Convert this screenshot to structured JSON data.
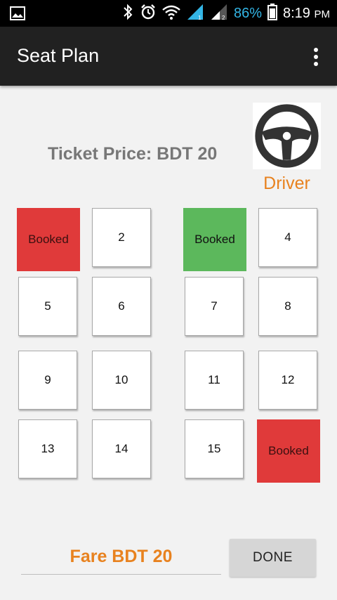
{
  "status_bar": {
    "battery_percent": "86%",
    "time": "8:19",
    "am_pm": "PM",
    "icons": [
      "image-icon",
      "bluetooth-icon",
      "alarm-icon",
      "wifi-icon",
      "signal-1-icon",
      "signal-2-icon",
      "battery-icon"
    ]
  },
  "app_bar": {
    "title": "Seat Plan",
    "menu_icon": "overflow-menu-icon"
  },
  "ticket_price": "Ticket Price: BDT 20",
  "driver": {
    "label": "Driver",
    "icon": "steering-wheel-icon"
  },
  "seats": [
    {
      "label": "Booked",
      "state": "booked-red"
    },
    {
      "label": "2",
      "state": "available"
    },
    {
      "label": "Booked",
      "state": "booked-green"
    },
    {
      "label": "4",
      "state": "available"
    },
    {
      "label": "5",
      "state": "available"
    },
    {
      "label": "6",
      "state": "available"
    },
    {
      "label": "7",
      "state": "available"
    },
    {
      "label": "8",
      "state": "available"
    },
    {
      "label": "9",
      "state": "available"
    },
    {
      "label": "10",
      "state": "available"
    },
    {
      "label": "11",
      "state": "available"
    },
    {
      "label": "12",
      "state": "available"
    },
    {
      "label": "13",
      "state": "available"
    },
    {
      "label": "14",
      "state": "available"
    },
    {
      "label": "15",
      "state": "available"
    },
    {
      "label": "Booked",
      "state": "booked-red"
    }
  ],
  "fare": "Fare BDT 20",
  "done_label": "DONE",
  "colors": {
    "booked_red": "#e03a3a",
    "selected_green": "#5cb85c",
    "accent_orange": "#e8821f",
    "status_blue": "#33b5e5"
  }
}
